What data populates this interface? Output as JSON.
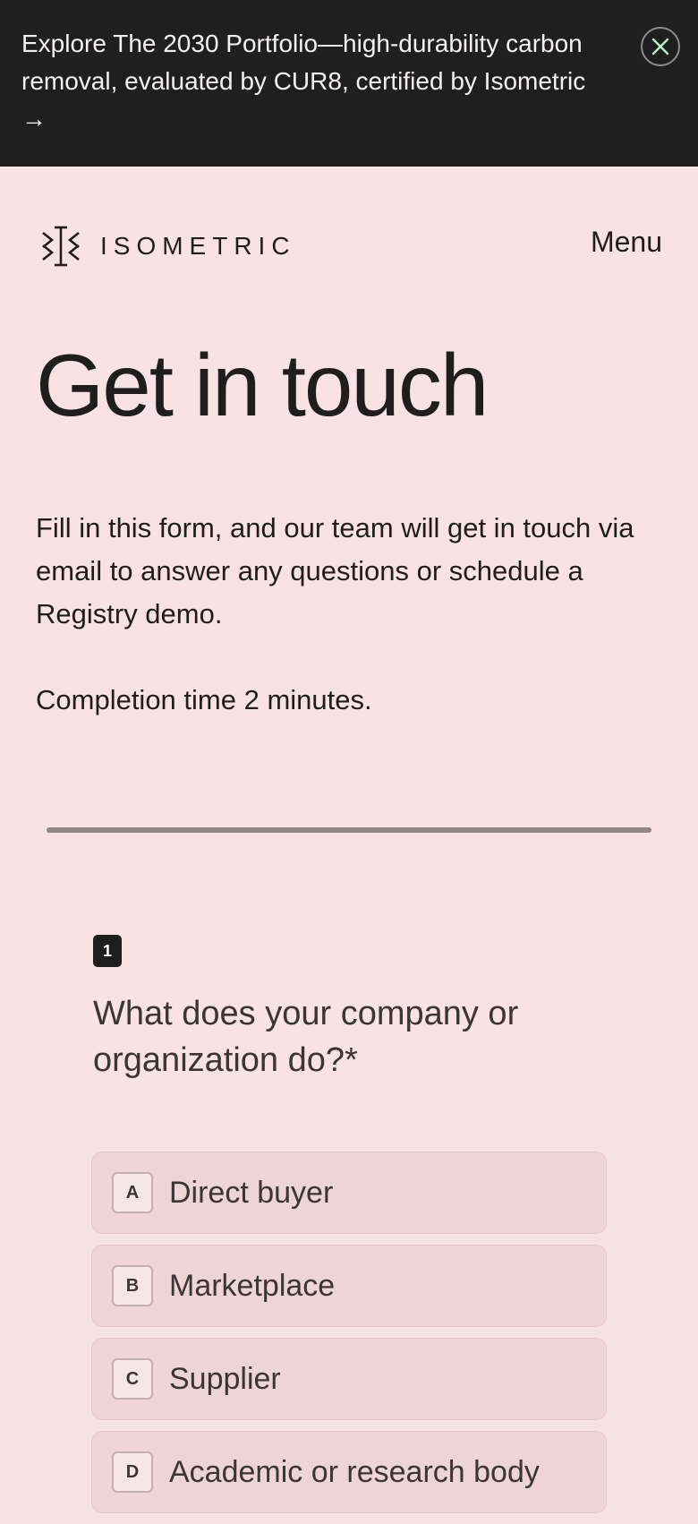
{
  "banner": {
    "text": "Explore The 2030 Portfolio—high-durability carbon removal, evaluated by CUR8, certified by Isometric →",
    "close_icon": "close-icon"
  },
  "nav": {
    "logo_text": "ISOMETRIC",
    "logo_icon": "isometric-logo-icon",
    "menu_label": "Menu"
  },
  "hero": {
    "title": "Get in touch",
    "intro": "Fill in this form, and our team will get in touch via email to answer any questions or schedule a Registry demo.",
    "completion": "Completion time 2 minutes."
  },
  "form": {
    "progress": 1.0,
    "question": {
      "number": "1",
      "text": "What does your company or organization do?*",
      "options": [
        {
          "key": "A",
          "label": "Direct buyer"
        },
        {
          "key": "B",
          "label": "Marketplace"
        },
        {
          "key": "C",
          "label": "Supplier"
        },
        {
          "key": "D",
          "label": "Academic or research body"
        }
      ]
    }
  },
  "colors": {
    "banner_bg": "#201f20",
    "page_bg": "#f9e2e5",
    "option_bg": "#efd4d7",
    "text": "#1f1e1f"
  }
}
